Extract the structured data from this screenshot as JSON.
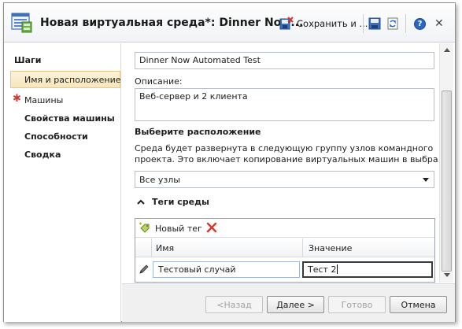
{
  "window": {
    "title": "Новая виртуальная среда*: Dinner Now...",
    "save_label": "Сохранить и ...",
    "help_glyph": "?",
    "close_glyph": "✕"
  },
  "nav": {
    "heading": "Шаги",
    "items": [
      {
        "label": "Имя и расположение",
        "selected": true,
        "required": false,
        "bold": false
      },
      {
        "label": "Машины",
        "selected": false,
        "required": true,
        "bold": false
      },
      {
        "label": "Свойства машины",
        "selected": false,
        "required": false,
        "bold": true
      },
      {
        "label": "Способности",
        "selected": false,
        "required": false,
        "bold": true
      },
      {
        "label": "Сводка",
        "selected": false,
        "required": false,
        "bold": true
      }
    ],
    "required_marker": "✱"
  },
  "form": {
    "name_value": "Dinner Now Automated Test",
    "description_label": "Описание:",
    "description_value": "Веб-сервер и 2 клиента",
    "location_heading": "Выберите расположение",
    "location_desc_line1": "Среда будет развернута в следующую группу узлов командного",
    "location_desc_line2": "проекта. Это включает копирование виртуальных машин в выбра...",
    "location_selected": "Все узлы"
  },
  "tags": {
    "section_label": "Теги среды",
    "new_tag_label": "Новый тег",
    "columns": [
      "Имя",
      "Значение"
    ],
    "rows": [
      {
        "name": "Тестовый случай",
        "value": "Тест 2"
      }
    ]
  },
  "footer": {
    "back_label": "<Назад",
    "next_label": "Далее >",
    "finish_label": "Готово",
    "cancel_label": "Отмена"
  },
  "colors": {
    "selected_bg": "#f8e6b8",
    "required_star": "#d23a2a",
    "delete_x": "#d9372a",
    "help_blue": "#2a66c4"
  }
}
